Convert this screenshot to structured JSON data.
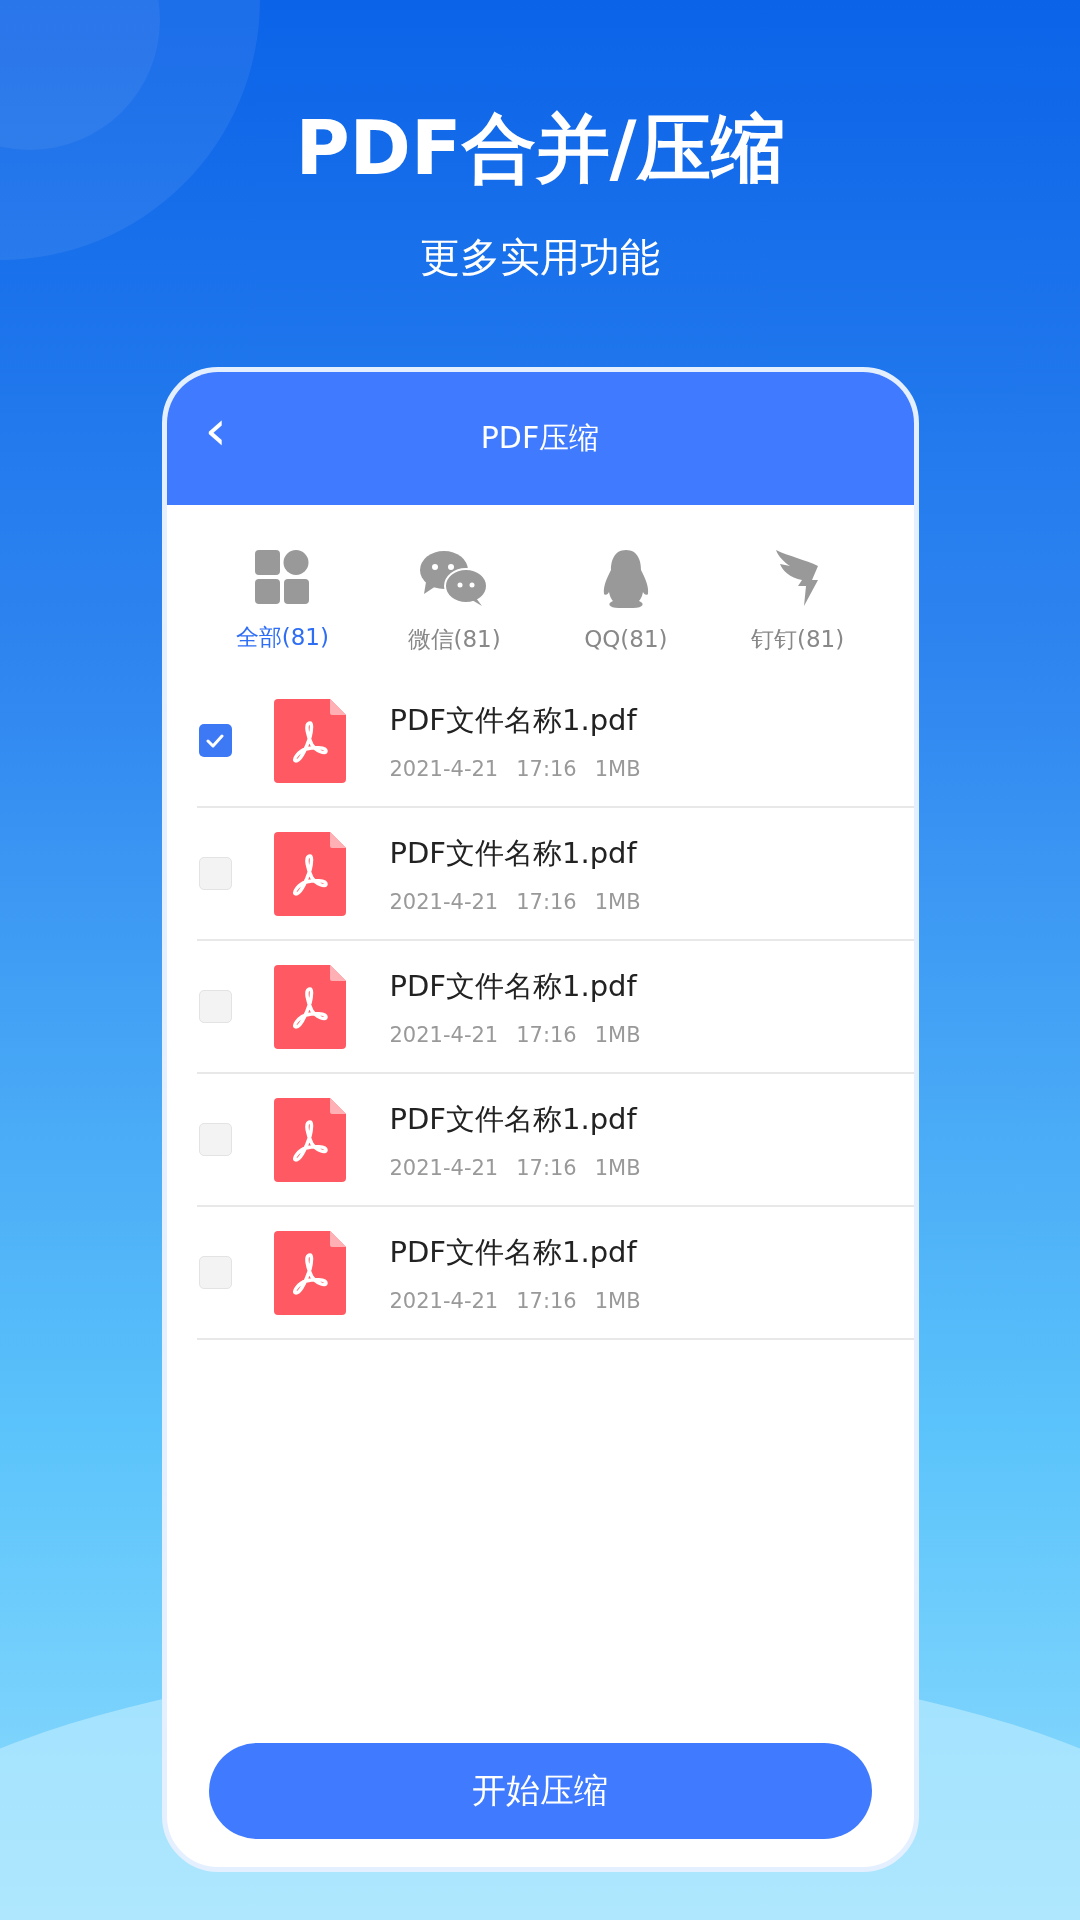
{
  "headline": "PDF合并/压缩",
  "subheadline": "更多实用功能",
  "phone": {
    "header": {
      "back": "‹",
      "title": "PDF压缩"
    },
    "tabs": [
      {
        "kind": "all",
        "label": "全部(81)",
        "selected": true
      },
      {
        "kind": "chat",
        "label": "微信(81)",
        "selected": false
      },
      {
        "kind": "penguin",
        "label": "QQ(81)",
        "selected": false
      },
      {
        "kind": "wing",
        "label": "钉钉(81)",
        "selected": false
      }
    ],
    "files": [
      {
        "name": "PDF文件名称1.pdf",
        "date": "2021-4-21",
        "time": "17:16",
        "size": "1MB",
        "checked": true
      },
      {
        "name": "PDF文件名称1.pdf",
        "date": "2021-4-21",
        "time": "17:16",
        "size": "1MB",
        "checked": false
      },
      {
        "name": "PDF文件名称1.pdf",
        "date": "2021-4-21",
        "time": "17:16",
        "size": "1MB",
        "checked": false
      },
      {
        "name": "PDF文件名称1.pdf",
        "date": "2021-4-21",
        "time": "17:16",
        "size": "1MB",
        "checked": false
      },
      {
        "name": "PDF文件名称1.pdf",
        "date": "2021-4-21",
        "time": "17:16",
        "size": "1MB",
        "checked": false
      }
    ],
    "action": "开始压缩"
  }
}
